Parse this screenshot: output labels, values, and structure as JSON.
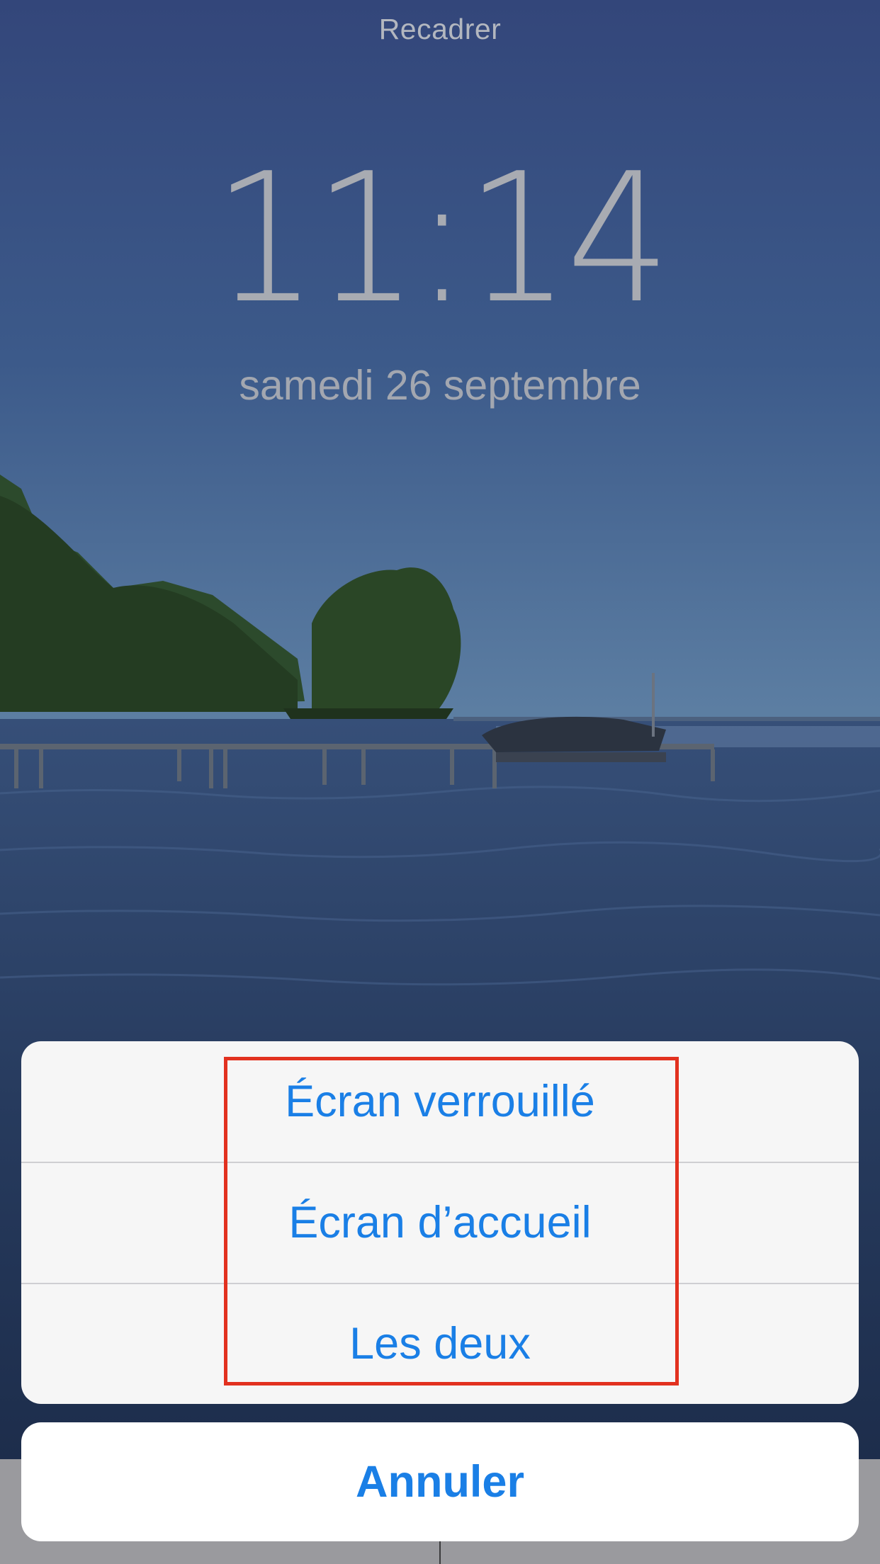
{
  "header": {
    "title": "Recadrer"
  },
  "lock_screen": {
    "time": "11:14",
    "date": "samedi 26 septembre"
  },
  "action_sheet": {
    "options": [
      {
        "label": "Écran verrouillé"
      },
      {
        "label": "Écran d’accueil"
      },
      {
        "label": "Les deux"
      }
    ],
    "cancel_label": "Annuler"
  },
  "colors": {
    "accent": "#1a7fe6",
    "highlight": "#e2311f",
    "sheet_bg": "#f6f6f6"
  }
}
